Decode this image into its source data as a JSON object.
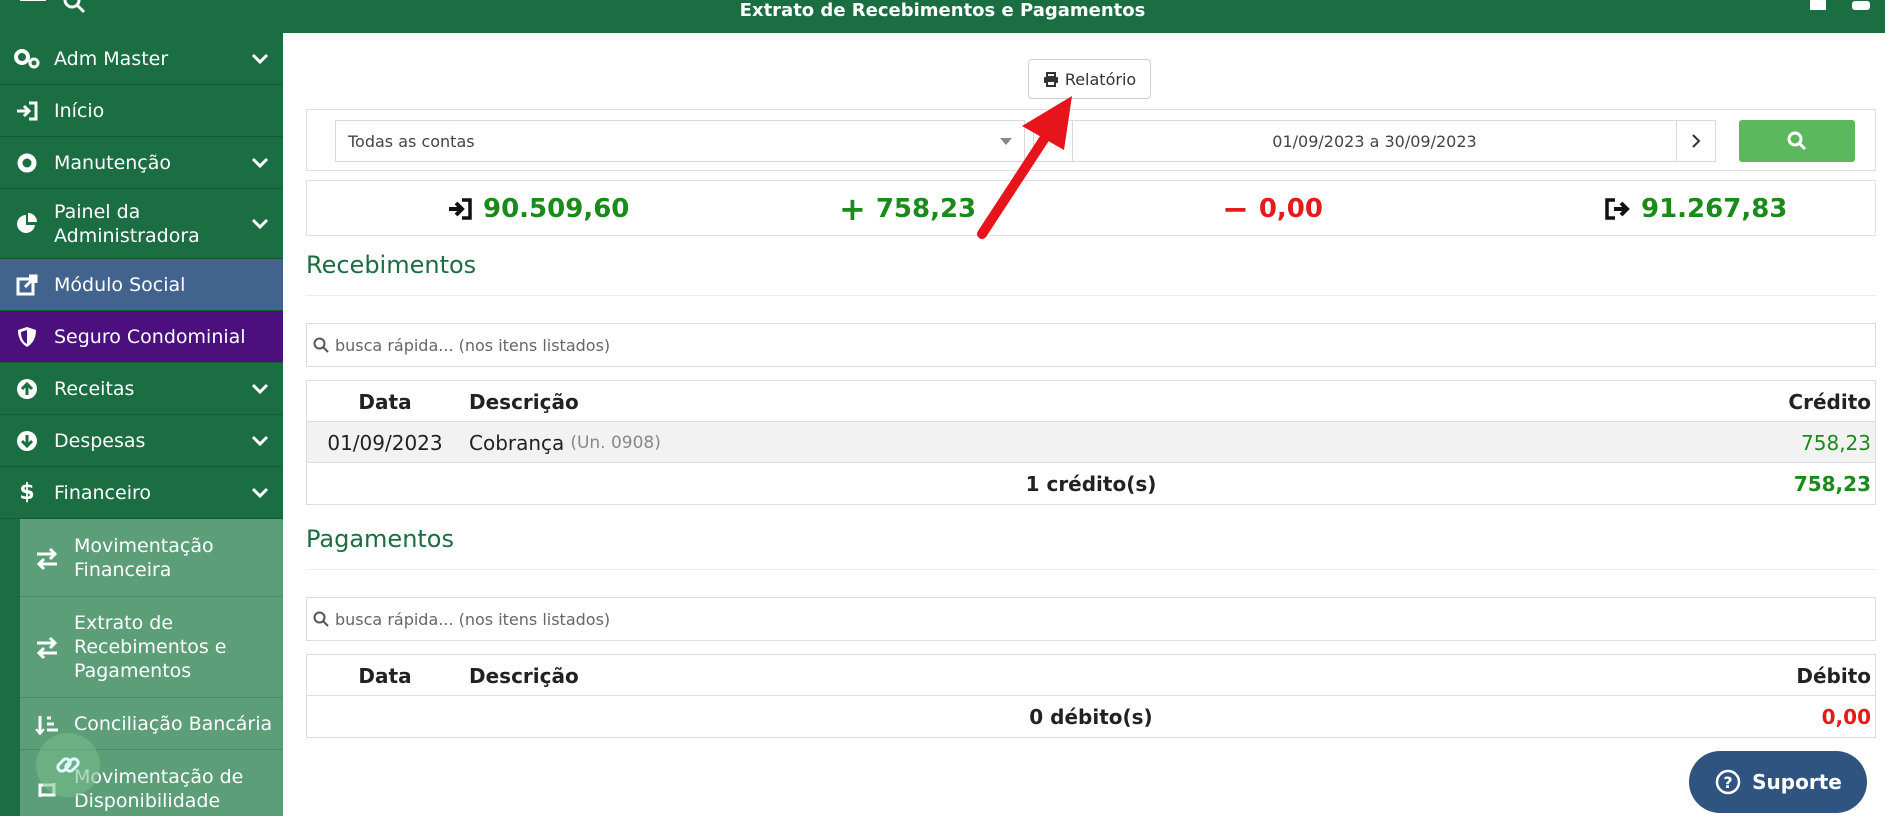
{
  "app": {
    "title": "Extrato de Recebimentos e Pagamentos"
  },
  "sidebar": {
    "items": [
      {
        "label": "Adm Master",
        "icon": "gears-icon"
      },
      {
        "label": "Início",
        "icon": "sign-in-icon"
      },
      {
        "label": "Manutenção",
        "icon": "gear-icon"
      },
      {
        "label": "Painel da Administradora",
        "icon": "pie-chart-icon"
      },
      {
        "label": "Módulo Social",
        "icon": "external-link-icon"
      },
      {
        "label": "Seguro Condominial",
        "icon": "shield-icon"
      },
      {
        "label": "Receitas",
        "icon": "arrow-circle-up-icon"
      },
      {
        "label": "Despesas",
        "icon": "arrow-circle-down-icon"
      },
      {
        "label": "Financeiro",
        "icon": "dollar-icon"
      }
    ],
    "subitems": [
      {
        "label": "Movimentação Financeira",
        "icon": "exchange-icon"
      },
      {
        "label": "Extrato de Recebimentos e Pagamentos",
        "icon": "exchange-icon"
      },
      {
        "label": "Conciliação Bancária",
        "icon": "sort-amount-icon"
      },
      {
        "label": "Movimentação de Disponibilidade",
        "icon": "retweet-icon"
      }
    ],
    "colors": {
      "primary": "#1b6d42",
      "social": "#43638f",
      "seguro": "#4b0f7e",
      "sub": "#5b9e78"
    }
  },
  "toolbar": {
    "report_label": "Relatório"
  },
  "filters": {
    "account_selected": "Todas as contas",
    "date_range": "01/09/2023 a 30/09/2023"
  },
  "summary": {
    "opening": "90.509,60",
    "credits": "758,23",
    "debits": "0,00",
    "closing": "91.267,83"
  },
  "receipts": {
    "title": "Recebimentos",
    "search_placeholder": "busca rápida... (nos itens listados)",
    "headers": {
      "date": "Data",
      "description": "Descrição",
      "value": "Crédito"
    },
    "rows": [
      {
        "date": "01/09/2023",
        "description": "Cobrança",
        "unit": "(Un. 0908)",
        "value": "758,23"
      }
    ],
    "footer": {
      "count": "1 crédito(s)",
      "total": "758,23"
    }
  },
  "payments": {
    "title": "Pagamentos",
    "search_placeholder": "busca rápida... (nos itens listados)",
    "headers": {
      "date": "Data",
      "description": "Descrição",
      "value": "Débito"
    },
    "footer": {
      "count": "0 débito(s)",
      "total": "0,00"
    }
  },
  "support": {
    "label": "Suporte"
  },
  "colors": {
    "credit_green": "#1a8a1a",
    "debit_red": "#e31b1b",
    "search_button": "#5cb85c",
    "annotation_arrow": "#e8141c"
  }
}
